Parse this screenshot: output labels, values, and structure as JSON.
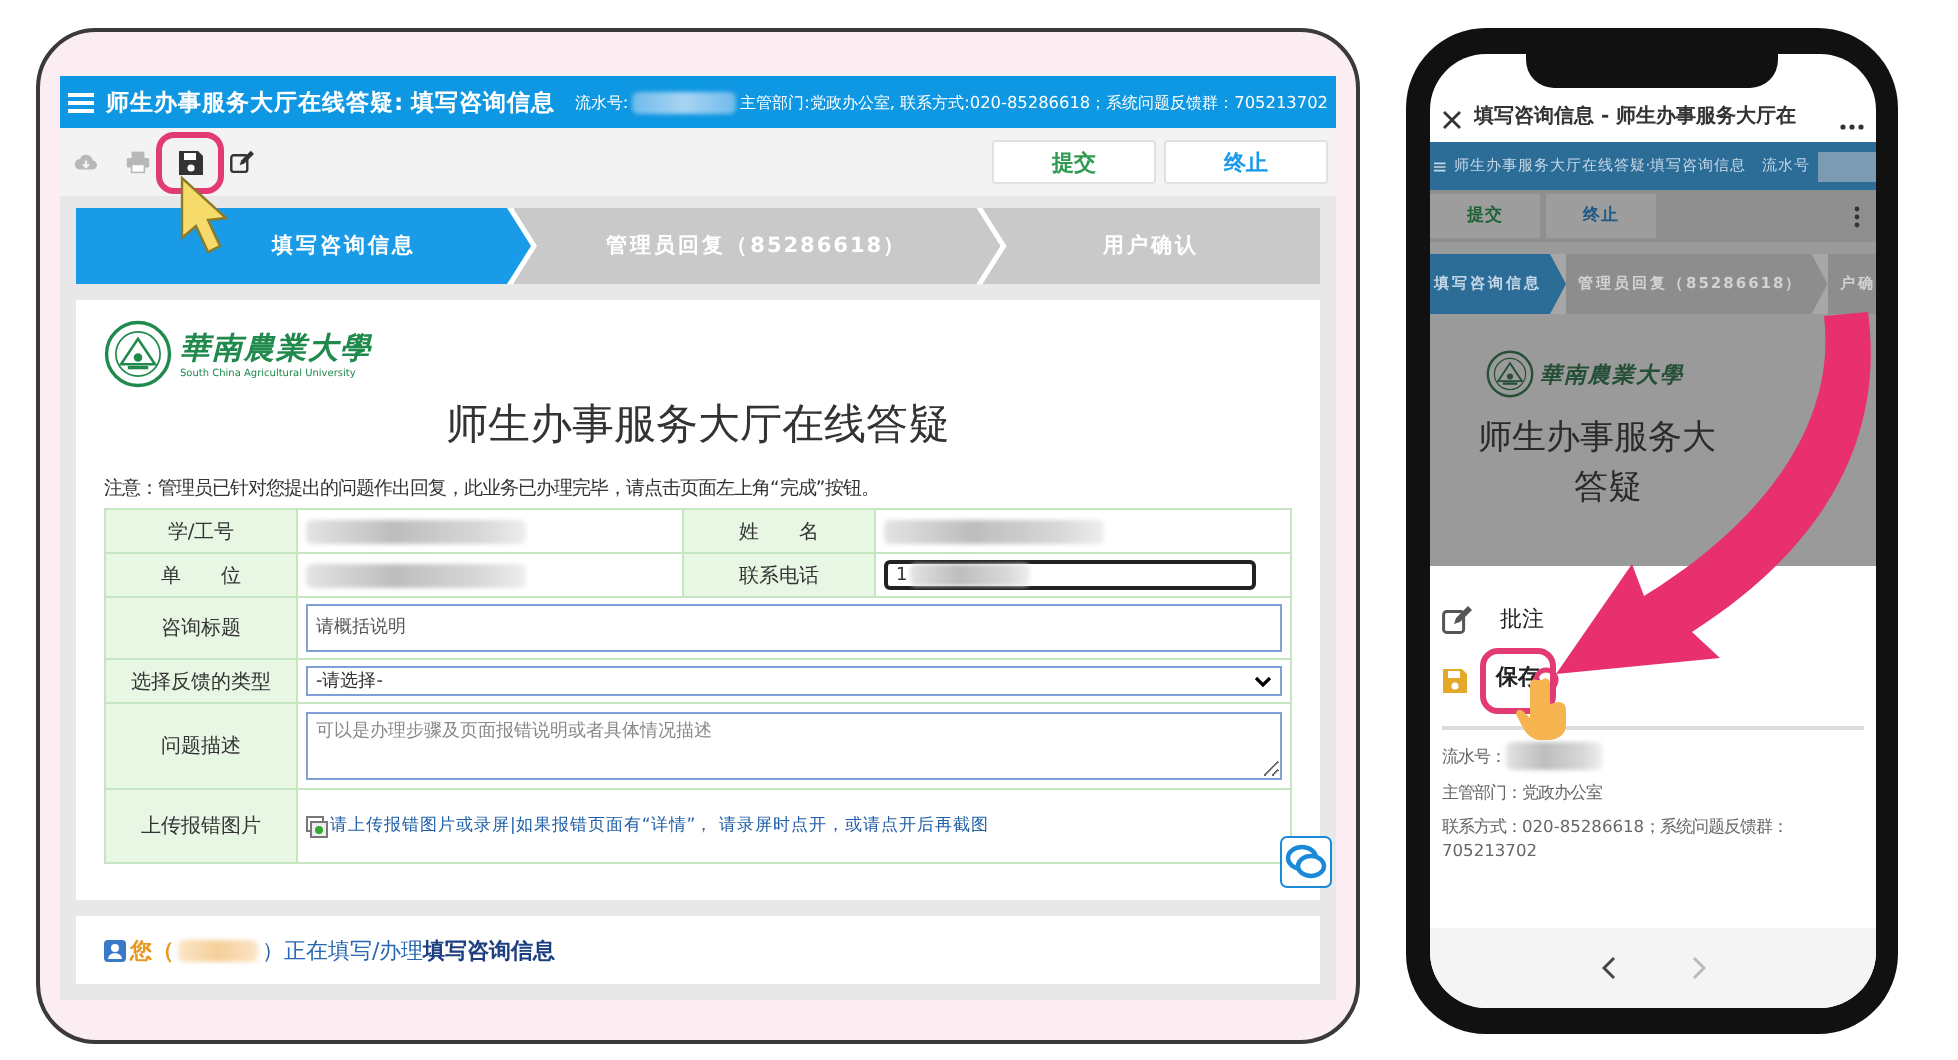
{
  "tablet": {
    "header": {
      "title": "师生办事服务大厅在线答疑: 填写咨询信息",
      "serial_label": "流水号:",
      "info": "主管部门:党政办公室, 联系方式:020-85286618；系统问题反馈群：705213702"
    },
    "toolbar": [
      {
        "kind": "download",
        "disabled": true,
        "highlighted": false
      },
      {
        "kind": "print",
        "disabled": true,
        "highlighted": false
      },
      {
        "kind": "save",
        "disabled": false,
        "highlighted": true
      },
      {
        "kind": "edit",
        "disabled": false,
        "highlighted": false
      }
    ],
    "actions": [
      {
        "label": "提交",
        "kind": "submit"
      },
      {
        "label": "终止",
        "kind": "stop"
      }
    ],
    "steps": [
      {
        "label": "填写咨询信息",
        "selected": true
      },
      {
        "label": "管理员回复（85286618）",
        "selected": false
      },
      {
        "label": "用户确认",
        "selected": false
      }
    ],
    "logo": {
      "name": "華南農業大學",
      "subtitle": "South China Agricultural University"
    },
    "title": "师生办事服务大厅在线答疑",
    "notice": "注意：管理员已针对您提出的问题作出回复，此业务已办理完毕，请点击页面左上角“完成”按钮。",
    "form": [
      {
        "kind": "pair",
        "fields": [
          {
            "label": "学/工号",
            "kind": "redacted"
          },
          {
            "label": "姓　　名",
            "kind": "redacted"
          }
        ]
      },
      {
        "kind": "pair",
        "fields": [
          {
            "label": "单　　位",
            "kind": "redacted"
          },
          {
            "label": "联系电话",
            "kind": "input",
            "value": "1"
          }
        ]
      },
      {
        "kind": "input",
        "label": "咨询标题",
        "placeholder": "请概括说明"
      },
      {
        "kind": "select",
        "label": "选择反馈的类型",
        "value": "-请选择-"
      },
      {
        "kind": "textarea",
        "label": "问题描述",
        "placeholder": "可以是办理步骤及页面报错说明或者具体情况描述"
      },
      {
        "kind": "upload",
        "label": "上传报错图片",
        "link": "请上传报错图片或录屏|如果报错页面有“详情”， 请录屏时点开，或请点开后再截图"
      }
    ],
    "status": {
      "prefix": "您（",
      "suffix": "）正在填写/办理**填写咨询信息**"
    }
  },
  "phone": {
    "title": "填写咨询信息 - 师生办事服务大厅在",
    "header": "师生办事服务大厅在线答疑·填写咨询信息",
    "serial_label": "流水号",
    "actions": [
      {
        "label": "提交",
        "kind": "submit"
      },
      {
        "label": "终止",
        "kind": "stop"
      }
    ],
    "steps": [
      {
        "label": "填写咨询信息",
        "selected": true
      },
      {
        "label": "管理员回复（85286618）",
        "selected": false
      },
      {
        "label": "户确",
        "selected": false
      }
    ],
    "logo_name": "華南農業大學",
    "title_lines": [
      "师生办事服务大",
      "答疑"
    ],
    "menu": [
      {
        "kind": "note",
        "label": "批注",
        "highlighted": false
      },
      {
        "kind": "save",
        "label": "保存",
        "highlighted": true
      }
    ],
    "info": [
      {
        "text": "流水号：",
        "redacted": true
      },
      {
        "text": "主管部门：党政办公室",
        "redacted": false
      },
      {
        "text": "联系方式：020-85286618；系统问题反馈群：705213702",
        "redacted": false
      }
    ]
  }
}
